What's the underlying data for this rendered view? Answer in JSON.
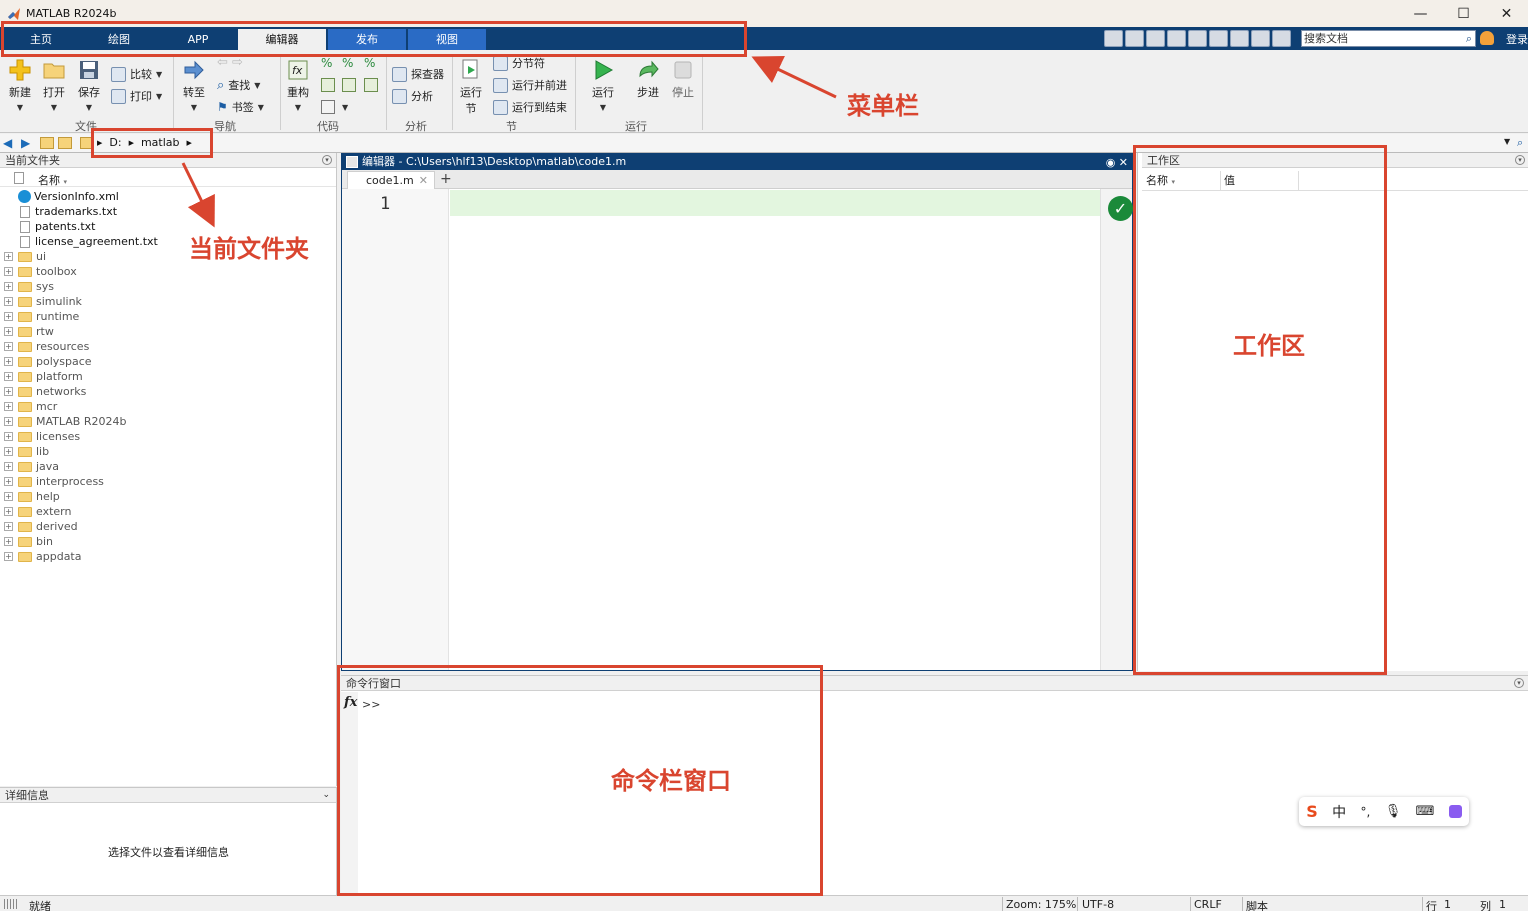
{
  "window": {
    "title": "MATLAB R2024b",
    "minimize": "—",
    "maximize": "☐",
    "close": "✕"
  },
  "tabs": [
    {
      "label": "主页"
    },
    {
      "label": "绘图"
    },
    {
      "label": "APP"
    },
    {
      "label": "编辑器"
    },
    {
      "label": "发布"
    },
    {
      "label": "视图"
    }
  ],
  "search": {
    "placeholder": "搜索文档"
  },
  "login": "登录",
  "toolstrip": {
    "new": "新建",
    "open": "打开",
    "save": "保存",
    "compare": "比较",
    "print": "打印",
    "goto": "转至",
    "find": "查找",
    "bookmark": "书签",
    "refactor": "重构",
    "profiler": "探查器",
    "analyze": "分析",
    "run_section": "运行\n节",
    "section_break": "分节符",
    "run_advance": "运行并前进",
    "run_to_end": "运行到结束",
    "run": "运行",
    "step": "步进",
    "stop": "停止",
    "groups": {
      "file": "文件",
      "navigate": "导航",
      "code": "代码",
      "analyze": "分析",
      "section": "节",
      "run": "运行"
    }
  },
  "address": {
    "drive": "D:",
    "folder": "matlab"
  },
  "current_folder": {
    "title": "当前文件夹",
    "col_name": "名称",
    "items": [
      {
        "name": "VersionInfo.xml",
        "kind": "xml"
      },
      {
        "name": "trademarks.txt",
        "kind": "txt"
      },
      {
        "name": "patents.txt",
        "kind": "txt"
      },
      {
        "name": "license_agreement.txt",
        "kind": "txt"
      },
      {
        "name": "ui",
        "kind": "folder"
      },
      {
        "name": "toolbox",
        "kind": "folder"
      },
      {
        "name": "sys",
        "kind": "folder"
      },
      {
        "name": "simulink",
        "kind": "folder"
      },
      {
        "name": "runtime",
        "kind": "folder"
      },
      {
        "name": "rtw",
        "kind": "folder"
      },
      {
        "name": "resources",
        "kind": "folder"
      },
      {
        "name": "polyspace",
        "kind": "folder"
      },
      {
        "name": "platform",
        "kind": "folder"
      },
      {
        "name": "networks",
        "kind": "folder"
      },
      {
        "name": "mcr",
        "kind": "folder"
      },
      {
        "name": "MATLAB R2024b",
        "kind": "folder"
      },
      {
        "name": "licenses",
        "kind": "folder"
      },
      {
        "name": "lib",
        "kind": "folder"
      },
      {
        "name": "java",
        "kind": "folder"
      },
      {
        "name": "interprocess",
        "kind": "folder"
      },
      {
        "name": "help",
        "kind": "folder"
      },
      {
        "name": "extern",
        "kind": "folder"
      },
      {
        "name": "derived",
        "kind": "folder"
      },
      {
        "name": "bin",
        "kind": "folder"
      },
      {
        "name": "appdata",
        "kind": "folder"
      }
    ]
  },
  "details": {
    "title": "详细信息",
    "message": "选择文件以查看详细信息"
  },
  "editor": {
    "title": "编辑器 - C:\\Users\\hlf13\\Desktop\\matlab\\code1.m",
    "tab": "code1.m",
    "line": "1"
  },
  "workspace": {
    "title": "工作区",
    "col_name": "名称",
    "col_value": "值"
  },
  "command": {
    "title": "命令行窗口",
    "fx": "fx",
    "prompt": ">>"
  },
  "status": {
    "state": "就绪",
    "zoom": "Zoom: 175%",
    "encoding": "UTF-8",
    "eol": "CRLF",
    "type": "脚本",
    "row_label": "行",
    "row": "1",
    "col_label": "列",
    "col": "1"
  },
  "ime": {
    "lang": "中"
  },
  "annotations": {
    "menu": "菜单栏",
    "folder": "当前文件夹",
    "workspace": "工作区",
    "command": "命令栏窗口"
  },
  "colors": {
    "annotation": "#d9452f",
    "tabbar": "#0e3f73",
    "current_line": "#e3f6df"
  }
}
